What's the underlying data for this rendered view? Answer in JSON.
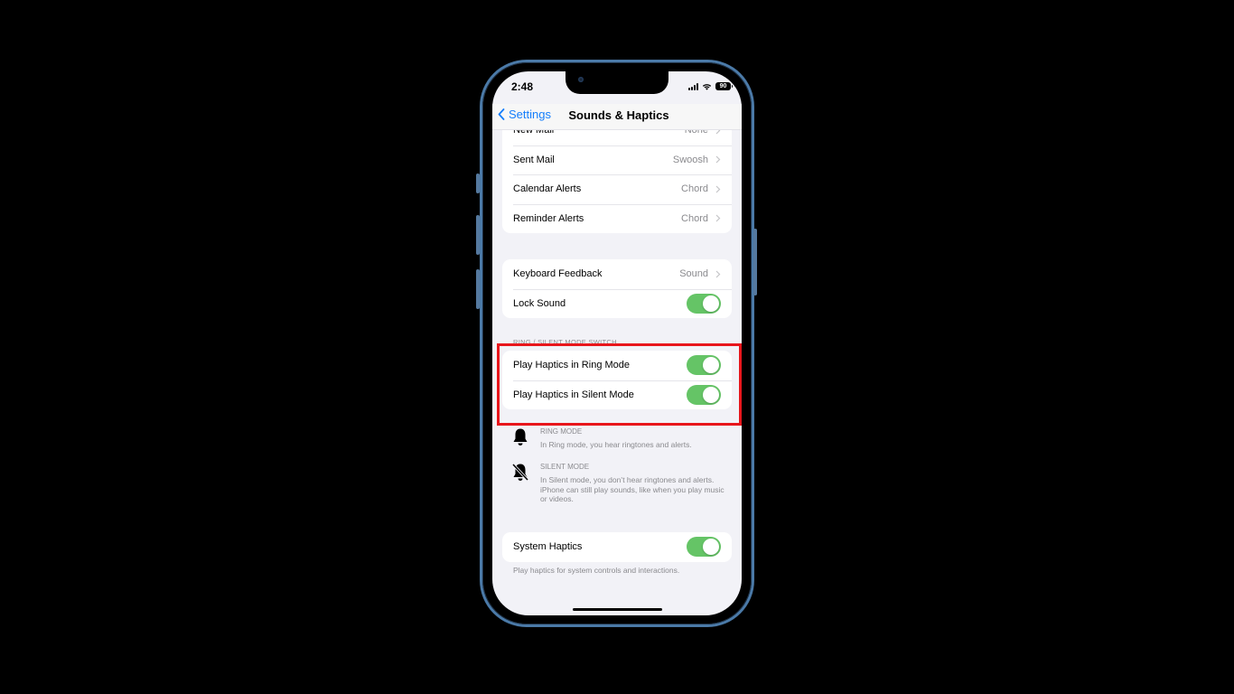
{
  "status_bar": {
    "time": "2:48",
    "battery": "90",
    "icons": [
      "cellular-signal-icon",
      "wifi-icon",
      "battery-icon"
    ]
  },
  "nav": {
    "back_label": "Settings",
    "title": "Sounds & Haptics"
  },
  "sound_patterns": [
    {
      "label": "New Mail",
      "value": "None"
    },
    {
      "label": "Sent Mail",
      "value": "Swoosh"
    },
    {
      "label": "Calendar Alerts",
      "value": "Chord"
    },
    {
      "label": "Reminder Alerts",
      "value": "Chord"
    }
  ],
  "feedback": {
    "keyboard_label": "Keyboard Feedback",
    "keyboard_value": "Sound",
    "lock_sound_label": "Lock Sound",
    "lock_sound_on": true
  },
  "ring_silent": {
    "header": "RING / SILENT MODE SWITCH",
    "ring_haptics_label": "Play Haptics in Ring Mode",
    "ring_haptics_on": true,
    "silent_haptics_label": "Play Haptics in Silent Mode",
    "silent_haptics_on": true
  },
  "modes": [
    {
      "icon": "bell-icon",
      "title": "RING MODE",
      "description": "In Ring mode, you hear ringtones and alerts."
    },
    {
      "icon": "bell-slash-icon",
      "title": "SILENT MODE",
      "description": "In Silent mode, you don’t hear ringtones and alerts. iPhone can still play sounds, like when you play music or videos."
    }
  ],
  "system_haptics": {
    "label": "System Haptics",
    "on": true,
    "footer": "Play haptics for system controls and interactions."
  },
  "colors": {
    "accent": "#147efb",
    "toggle_on": "#65c466",
    "highlight": "#e8161c",
    "phone_frame": "#4b7aa8"
  }
}
